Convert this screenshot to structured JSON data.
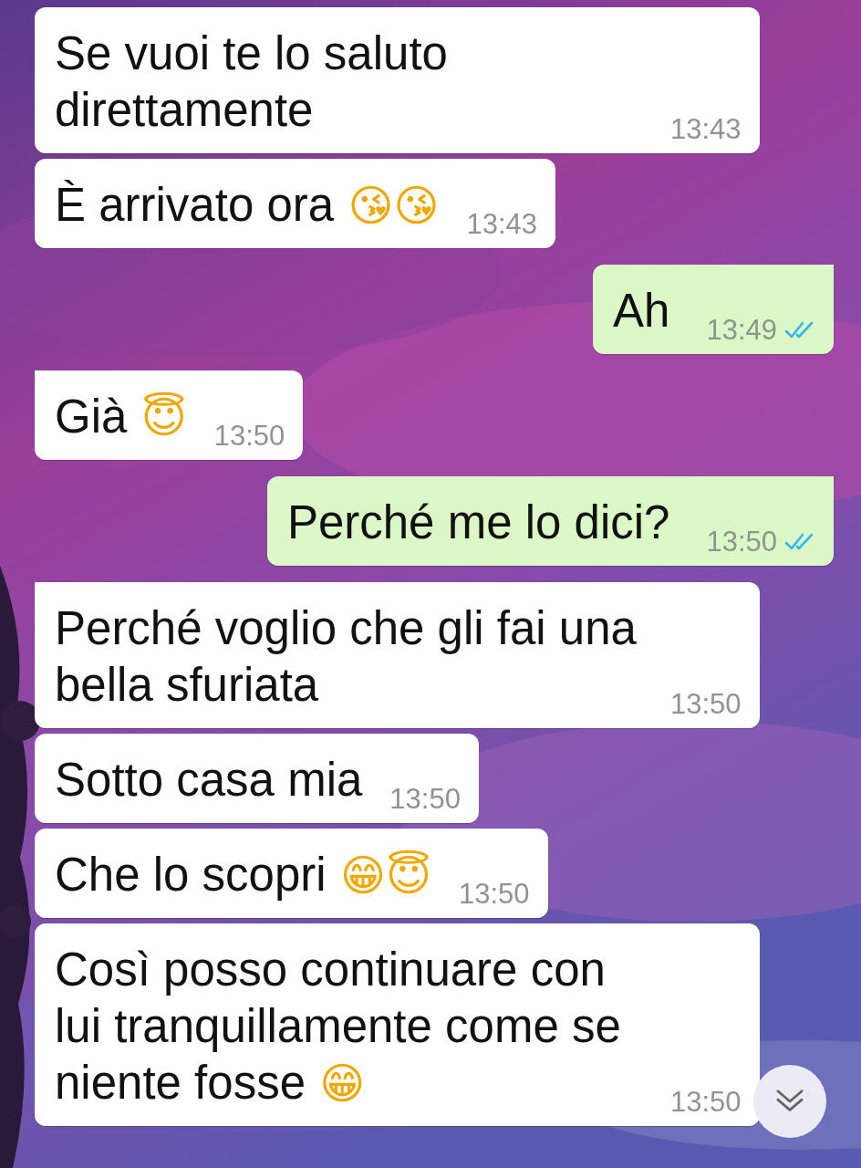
{
  "messages": [
    {
      "kind": "incoming",
      "tail": false,
      "text": "Se vuoi te lo saluto direttamente",
      "time": "13:43"
    },
    {
      "kind": "incoming",
      "tail": false,
      "text": "È arrivato ora",
      "emoji": "😘😘",
      "time": "13:43"
    },
    {
      "kind": "outgoing",
      "tail": true,
      "text": "Ah",
      "time": "13:49",
      "read": true
    },
    {
      "kind": "incoming",
      "tail": true,
      "text": "Già",
      "emoji": "😇",
      "time": "13:50"
    },
    {
      "kind": "outgoing",
      "tail": true,
      "text": "Perché me lo dici?",
      "time": "13:50",
      "read": true
    },
    {
      "kind": "incoming",
      "tail": true,
      "text": "Perché voglio che gli fai una bella sfuriata",
      "time": "13:50"
    },
    {
      "kind": "incoming",
      "tail": false,
      "text": "Sotto casa mia",
      "time": "13:50"
    },
    {
      "kind": "incoming",
      "tail": false,
      "text": "Che lo scopri",
      "emoji": "😁😇",
      "time": "13:50"
    },
    {
      "kind": "incoming",
      "tail": false,
      "text": "Così posso continuare con lui tranquillamente come se niente fosse",
      "emoji": "😁",
      "time": "13:50"
    }
  ]
}
